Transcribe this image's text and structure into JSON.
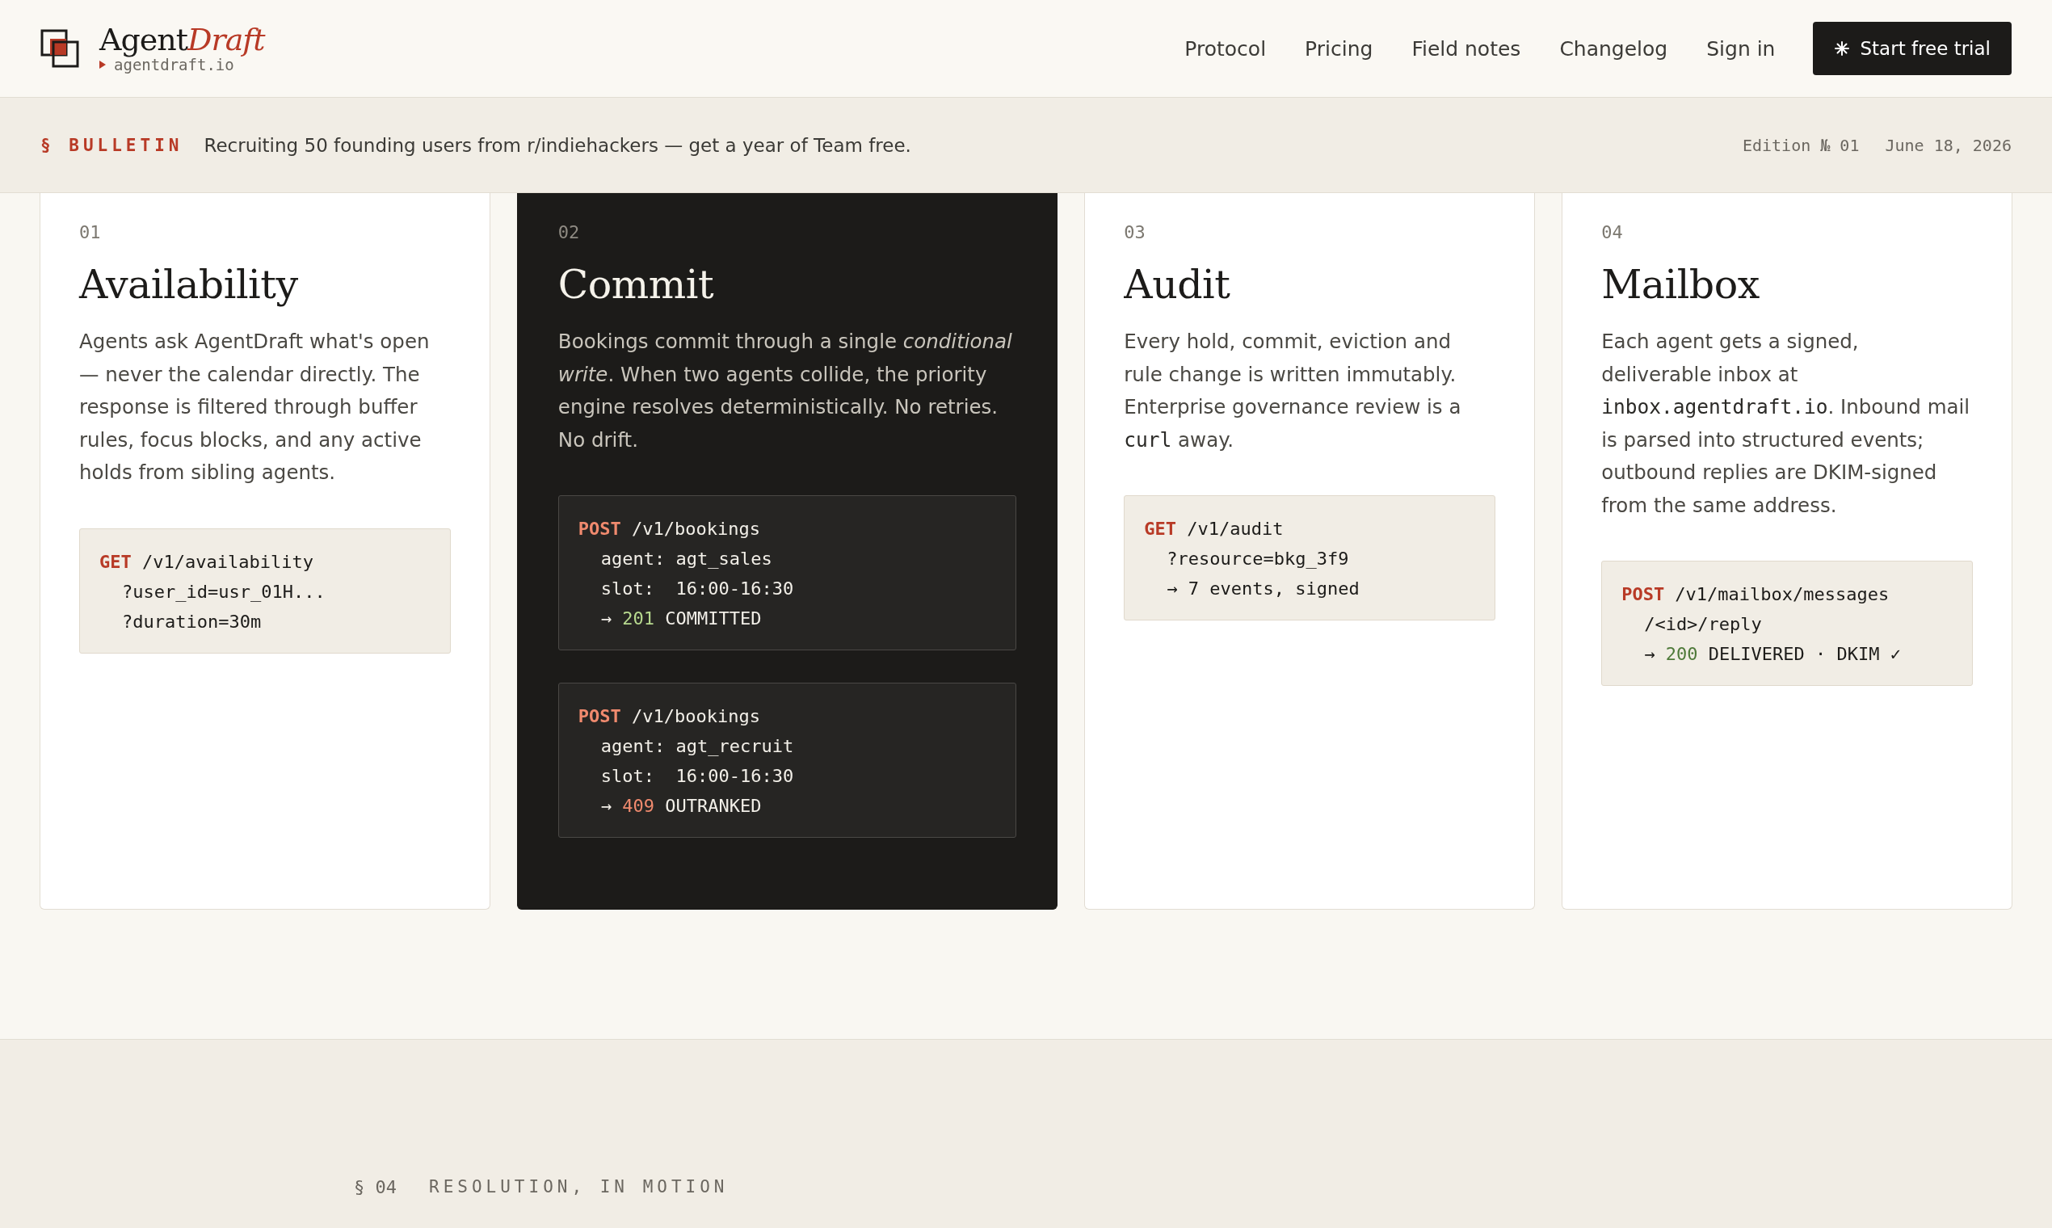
{
  "header": {
    "brand": {
      "name": "Agent",
      "name_accent": "Draft",
      "domain": "agentdraft.io"
    },
    "nav": [
      {
        "label": "Protocol"
      },
      {
        "label": "Pricing"
      },
      {
        "label": "Field notes"
      },
      {
        "label": "Changelog"
      },
      {
        "label": "Sign in"
      }
    ],
    "cta": {
      "label": "Start free trial"
    }
  },
  "bulletin": {
    "tag": "§ BULLETIN",
    "message": "Recruiting 50 founding users from r/indiehackers — get a year of Team free.",
    "edition": "Edition № 01",
    "date": "June 18, 2026"
  },
  "cards": [
    {
      "number": "01",
      "title": "Availability",
      "dark": false,
      "description": [
        {
          "kind": "text",
          "text": "Agents ask AgentDraft what's open — never the calendar directly. The response is filtered through buffer rules, focus blocks, and any active holds from sibling agents."
        }
      ],
      "code_blocks": [
        {
          "lines": [
            {
              "indent": false,
              "segments": [
                {
                  "kind": "method",
                  "text": "GET"
                },
                {
                  "kind": "plain",
                  "text": " /v1/availability"
                }
              ]
            },
            {
              "indent": true,
              "segments": [
                {
                  "kind": "plain",
                  "text": "?user_id=usr_01H..."
                }
              ]
            },
            {
              "indent": true,
              "segments": [
                {
                  "kind": "plain",
                  "text": "?duration=30m"
                }
              ]
            }
          ]
        }
      ]
    },
    {
      "number": "02",
      "title": "Commit",
      "dark": true,
      "description": [
        {
          "kind": "text",
          "text": "Bookings commit through a single "
        },
        {
          "kind": "italic",
          "text": "conditional write"
        },
        {
          "kind": "text",
          "text": ". When two agents collide, the priority engine resolves deterministically. No retries. No drift."
        }
      ],
      "code_blocks": [
        {
          "lines": [
            {
              "indent": false,
              "segments": [
                {
                  "kind": "method",
                  "text": "POST"
                },
                {
                  "kind": "plain",
                  "text": " /v1/bookings"
                }
              ]
            },
            {
              "indent": true,
              "segments": [
                {
                  "kind": "plain",
                  "text": "agent: agt_sales"
                }
              ]
            },
            {
              "indent": true,
              "segments": [
                {
                  "kind": "plain",
                  "text": "slot:  16:00-16:30"
                }
              ]
            },
            {
              "indent": true,
              "segments": [
                {
                  "kind": "plain",
                  "text": "→ "
                },
                {
                  "kind": "success",
                  "text": "201"
                },
                {
                  "kind": "plain",
                  "text": " COMMITTED"
                }
              ]
            }
          ]
        },
        {
          "lines": [
            {
              "indent": false,
              "segments": [
                {
                  "kind": "method",
                  "text": "POST"
                },
                {
                  "kind": "plain",
                  "text": " /v1/bookings"
                }
              ]
            },
            {
              "indent": true,
              "segments": [
                {
                  "kind": "plain",
                  "text": "agent: agt_recruit"
                }
              ]
            },
            {
              "indent": true,
              "segments": [
                {
                  "kind": "plain",
                  "text": "slot:  16:00-16:30"
                }
              ]
            },
            {
              "indent": true,
              "segments": [
                {
                  "kind": "plain",
                  "text": "→ "
                },
                {
                  "kind": "error",
                  "text": "409"
                },
                {
                  "kind": "plain",
                  "text": " OUTRANKED"
                }
              ]
            }
          ]
        }
      ]
    },
    {
      "number": "03",
      "title": "Audit",
      "dark": false,
      "description": [
        {
          "kind": "text",
          "text": "Every hold, commit, eviction and rule change is written immutably. Enterprise governance review is a "
        },
        {
          "kind": "code",
          "text": "curl"
        },
        {
          "kind": "text",
          "text": " away."
        }
      ],
      "code_blocks": [
        {
          "lines": [
            {
              "indent": false,
              "segments": [
                {
                  "kind": "method",
                  "text": "GET"
                },
                {
                  "kind": "plain",
                  "text": " /v1/audit"
                }
              ]
            },
            {
              "indent": true,
              "segments": [
                {
                  "kind": "plain",
                  "text": "?resource=bkg_3f9"
                }
              ]
            },
            {
              "indent": true,
              "segments": [
                {
                  "kind": "plain",
                  "text": "→ 7 events, signed"
                }
              ]
            }
          ]
        }
      ]
    },
    {
      "number": "04",
      "title": "Mailbox",
      "dark": false,
      "description": [
        {
          "kind": "text",
          "text": "Each agent gets a signed, deliverable inbox at "
        },
        {
          "kind": "code",
          "text": "inbox.agentdraft.io"
        },
        {
          "kind": "text",
          "text": ". Inbound mail is parsed into structured events; outbound replies are DKIM-signed from the same address."
        }
      ],
      "code_blocks": [
        {
          "lines": [
            {
              "indent": false,
              "segments": [
                {
                  "kind": "method",
                  "text": "POST"
                },
                {
                  "kind": "plain",
                  "text": " /v1/mailbox/messages"
                }
              ]
            },
            {
              "indent": true,
              "segments": [
                {
                  "kind": "plain",
                  "text": "/<id>/reply"
                }
              ]
            },
            {
              "indent": true,
              "segments": [
                {
                  "kind": "plain",
                  "text": "→ "
                },
                {
                  "kind": "success",
                  "text": "200"
                },
                {
                  "kind": "plain",
                  "text": " DELIVERED · DKIM ✓"
                }
              ]
            }
          ]
        }
      ]
    }
  ],
  "next_section": {
    "number": "§ 04",
    "label": "RESOLUTION, IN MOTION"
  }
}
